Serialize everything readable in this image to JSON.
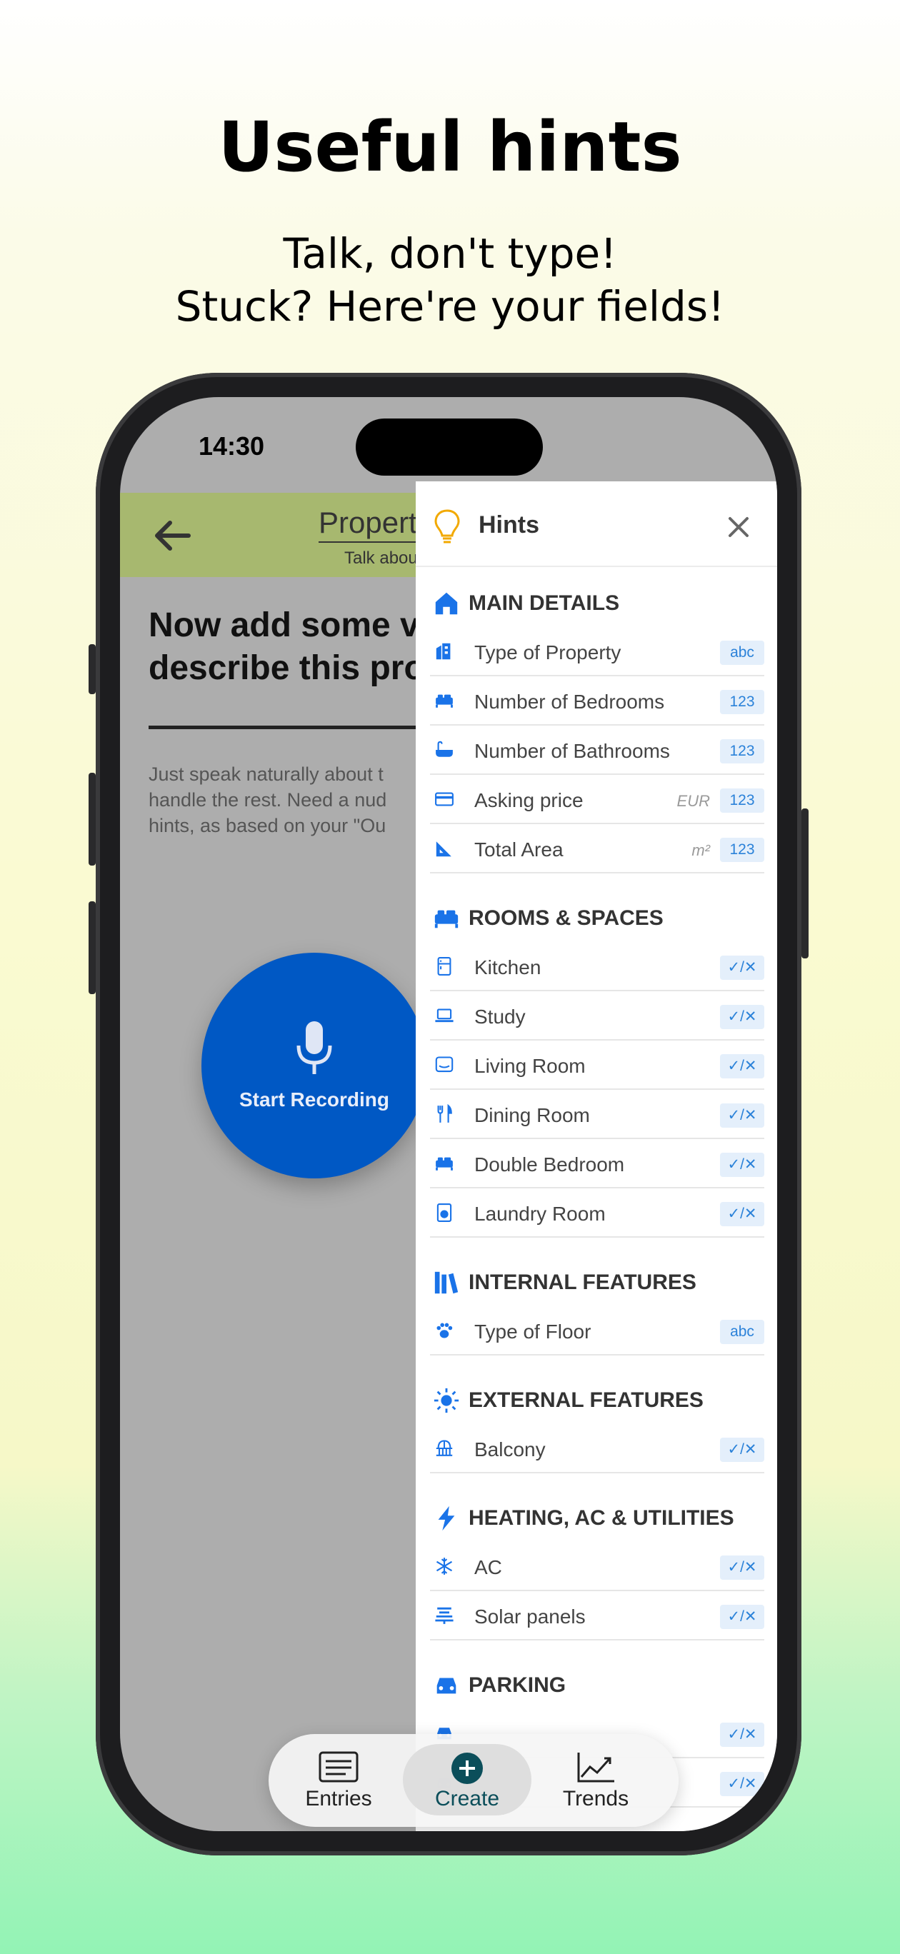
{
  "promo": {
    "headline": "Useful hints",
    "subline": "Talk, don't type!\nStuck? Here're your fields!"
  },
  "status_bar": {
    "time": "14:30"
  },
  "app": {
    "brand_title": "Property",
    "brand_subtitle": "Talk about",
    "heading": "Now add some v\ndescribe this pro",
    "body": "Just speak naturally about t\nhandle the rest. Need a nud\nhints, as based on your \"Ou",
    "record_label": "Start Recording",
    "accent_color": "#0058c4",
    "header_color": "#a7b86f"
  },
  "hints": {
    "title": "Hints",
    "sections": [
      {
        "title": "MAIN DETAILS",
        "icon": "home-icon",
        "rows": [
          {
            "label": "Type of Property",
            "icon": "building-icon",
            "badge": "abc",
            "unit": ""
          },
          {
            "label": "Number of Bedrooms",
            "icon": "bed-icon",
            "badge": "123",
            "unit": ""
          },
          {
            "label": "Number of Bathrooms",
            "icon": "bath-icon",
            "badge": "123",
            "unit": ""
          },
          {
            "label": "Asking price",
            "icon": "card-icon",
            "badge": "123",
            "unit": "EUR"
          },
          {
            "label": "Total Area",
            "icon": "ruler-icon",
            "badge": "123",
            "unit": "m²"
          }
        ]
      },
      {
        "title": "ROOMS & SPACES",
        "icon": "bed-icon",
        "rows": [
          {
            "label": "Kitchen",
            "icon": "fridge-icon",
            "badge": "✓/✕",
            "unit": ""
          },
          {
            "label": "Study",
            "icon": "laptop-icon",
            "badge": "✓/✕",
            "unit": ""
          },
          {
            "label": "Living Room",
            "icon": "tv-icon",
            "badge": "✓/✕",
            "unit": ""
          },
          {
            "label": "Dining Room",
            "icon": "utensils-icon",
            "badge": "✓/✕",
            "unit": ""
          },
          {
            "label": "Double Bedroom",
            "icon": "bed-icon",
            "badge": "✓/✕",
            "unit": ""
          },
          {
            "label": "Laundry Room",
            "icon": "washer-icon",
            "badge": "✓/✕",
            "unit": ""
          }
        ]
      },
      {
        "title": "INTERNAL FEATURES",
        "icon": "books-icon",
        "rows": [
          {
            "label": "Type of Floor",
            "icon": "paw-icon",
            "badge": "abc",
            "unit": ""
          }
        ]
      },
      {
        "title": "EXTERNAL FEATURES",
        "icon": "sun-icon",
        "rows": [
          {
            "label": "Balcony",
            "icon": "balcony-icon",
            "badge": "✓/✕",
            "unit": ""
          }
        ]
      },
      {
        "title": "HEATING, AC & UTILITIES",
        "icon": "bolt-icon",
        "rows": [
          {
            "label": "AC",
            "icon": "snowflake-icon",
            "badge": "✓/✕",
            "unit": ""
          },
          {
            "label": "Solar panels",
            "icon": "solar-icon",
            "badge": "✓/✕",
            "unit": ""
          }
        ]
      },
      {
        "title": "PARKING",
        "icon": "car-icon",
        "rows": [
          {
            "label": "",
            "icon": "car-icon",
            "badge": "✓/✕",
            "unit": ""
          },
          {
            "label": "",
            "icon": "car-icon",
            "badge": "✓/✕",
            "unit": ""
          }
        ]
      }
    ]
  },
  "tabbar": {
    "tabs": [
      {
        "label": "Entries",
        "icon": "list-icon",
        "active": false
      },
      {
        "label": "Create",
        "icon": "plus-circle-icon",
        "active": true
      },
      {
        "label": "Trends",
        "icon": "chart-icon",
        "active": false
      }
    ]
  }
}
